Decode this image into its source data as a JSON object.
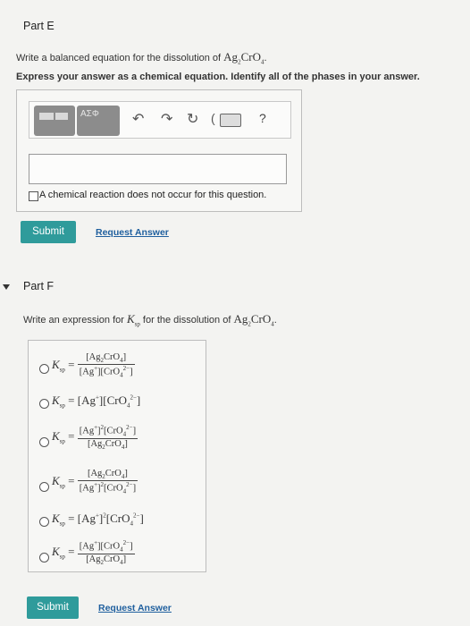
{
  "part_e": {
    "title": "Part E",
    "prompt_text": "Write a balanced equation for the dissolution of ",
    "compound": "Ag",
    "compound_sub1": "2",
    "compound_mid": "CrO",
    "compound_sub2": "4",
    "instruction": "Express your answer as a chemical equation. Identify all of the phases in your answer.",
    "toolbar_symbol_label": "ΑΣΦ",
    "toolbar_help": "?",
    "checkbox_label": "A chemical reaction does not occur for this question.",
    "submit_label": "Submit",
    "request_label": "Request Answer"
  },
  "part_f": {
    "title": "Part F",
    "prompt_text": "Write an expression for ",
    "prompt_mid": " for the dissolution of ",
    "submit_label": "Submit",
    "request_label": "Request Answer"
  }
}
